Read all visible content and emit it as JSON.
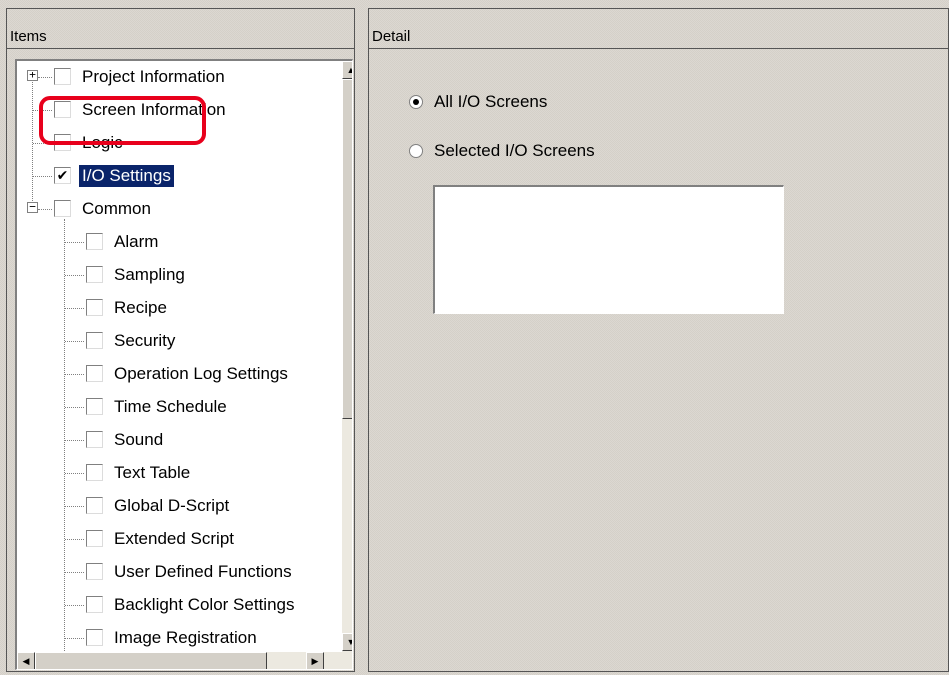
{
  "items_panel": {
    "header": "Items",
    "tree": [
      {
        "label": "Project Information",
        "checked": false,
        "expander": "+"
      },
      {
        "label": "Screen Information",
        "checked": false
      },
      {
        "label": "Logic",
        "checked": false
      },
      {
        "label": "I/O Settings",
        "checked": true,
        "selected": true
      },
      {
        "label": "Common",
        "checked": false,
        "expander": "-"
      },
      {
        "label": "Alarm",
        "checked": false
      },
      {
        "label": "Sampling",
        "checked": false
      },
      {
        "label": "Recipe",
        "checked": false
      },
      {
        "label": "Security",
        "checked": false
      },
      {
        "label": "Operation Log Settings",
        "checked": false
      },
      {
        "label": "Time Schedule",
        "checked": false
      },
      {
        "label": "Sound",
        "checked": false
      },
      {
        "label": "Text Table",
        "checked": false
      },
      {
        "label": "Global D-Script",
        "checked": false
      },
      {
        "label": "Extended Script",
        "checked": false
      },
      {
        "label": "User Defined Functions",
        "checked": false
      },
      {
        "label": "Backlight Color Settings",
        "checked": false
      },
      {
        "label": "Image Registration",
        "checked": false
      }
    ]
  },
  "detail_panel": {
    "header": "Detail",
    "options": [
      {
        "label": "All I/O Screens",
        "selected": true
      },
      {
        "label": "Selected I/O Screens",
        "selected": false
      }
    ]
  },
  "colors": {
    "selection_bg": "#0a246a",
    "highlight_ring": "#e8001c",
    "panel_bg": "#d4d0c8"
  },
  "icons": {
    "expand": "plus-expander-icon",
    "collapse": "minus-expander-icon",
    "check": "checkmark-icon",
    "scroll_up": "arrow-up-icon",
    "scroll_down": "arrow-down-icon",
    "scroll_left": "arrow-left-icon",
    "scroll_right": "arrow-right-icon"
  }
}
